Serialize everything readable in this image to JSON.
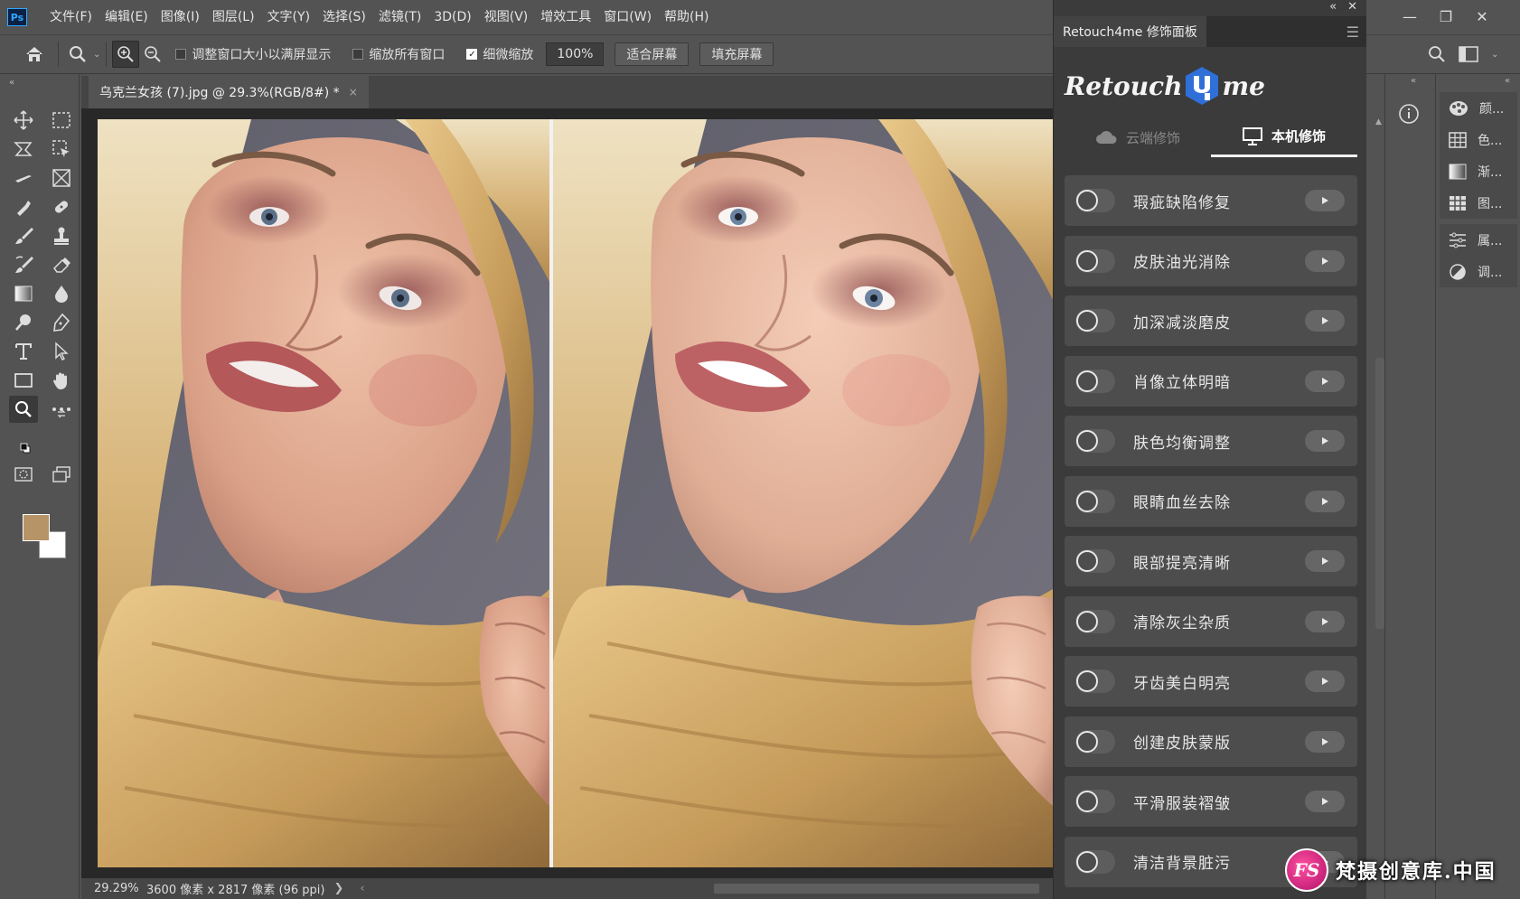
{
  "menubar": {
    "app_logo": "Ps",
    "items": [
      "文件(F)",
      "编辑(E)",
      "图像(I)",
      "图层(L)",
      "文字(Y)",
      "选择(S)",
      "滤镜(T)",
      "3D(D)",
      "视图(V)",
      "增效工具",
      "窗口(W)",
      "帮助(H)"
    ],
    "window_controls": [
      "minimize",
      "maximize",
      "close"
    ]
  },
  "options": {
    "checkbox1": "调整窗口大小以满屏显示",
    "checkbox1_checked": false,
    "checkbox2": "缩放所有窗口",
    "checkbox2_checked": false,
    "checkbox3": "细微缩放",
    "checkbox3_checked": true,
    "zoom_value": "100%",
    "fit_screen": "适合屏幕",
    "fill_screen": "填充屏幕"
  },
  "document": {
    "tab_title": "乌克兰女孩 (7).jpg @ 29.3%(RGB/8#) *",
    "tab_close": "×"
  },
  "status": {
    "zoom": "29.29%",
    "info": "3600 像素 x 2817 像素 (96 ppi)",
    "arrow": "❯"
  },
  "toolbar": {
    "foreground_color": "#b79468",
    "background_color": "#ffffff"
  },
  "retouch": {
    "panel_title": "Retouch4me 修饰面板",
    "logo_part1": "Retouch",
    "logo_part2": "me",
    "tab_cloud": "云端修饰",
    "tab_local": "本机修饰",
    "active_tab": "本机修饰",
    "items": [
      {
        "label": "瑕疵缺陷修复"
      },
      {
        "label": "皮肤油光消除"
      },
      {
        "label": "加深减淡磨皮"
      },
      {
        "label": "肖像立体明暗"
      },
      {
        "label": "肤色均衡调整"
      },
      {
        "label": "眼睛血丝去除"
      },
      {
        "label": "眼部提亮清晰"
      },
      {
        "label": "清除灰尘杂质"
      },
      {
        "label": "牙齿美白明亮"
      },
      {
        "label": "创建皮肤蒙版"
      },
      {
        "label": "平滑服装褶皱"
      },
      {
        "label": "清洁背景脏污"
      }
    ]
  },
  "dock": {
    "items": [
      {
        "label": "颜...",
        "icon": "palette-icon"
      },
      {
        "label": "色...",
        "icon": "swatches-icon"
      },
      {
        "label": "渐...",
        "icon": "gradient-icon"
      },
      {
        "label": "图...",
        "icon": "patterns-icon"
      },
      {
        "label": "属...",
        "icon": "properties-icon"
      },
      {
        "label": "调...",
        "icon": "adjustments-icon"
      }
    ]
  },
  "watermark": {
    "logo": "FS",
    "text": "梵摄创意库.中国"
  }
}
